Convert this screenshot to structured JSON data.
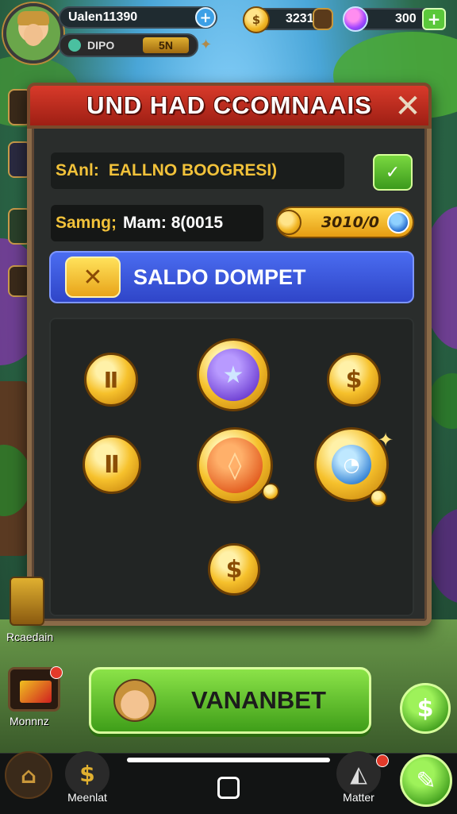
{
  "player": {
    "name": "Ualen11390",
    "rank_label": "DIPO",
    "rank_value": "5N"
  },
  "currency": {
    "coins": "3231",
    "gems": "300"
  },
  "modal": {
    "title": "UND HAD CCOMNAAIS",
    "close": "✕",
    "row1_label": "SAnl:",
    "row1_value": "EALLNO BOOGRESI)",
    "row2_label": "Samng;",
    "row2_name": "Mam: 8(0015",
    "balance": "3010/0",
    "saldo_label": "SALDO DOMPET",
    "saldo_icon": "✕"
  },
  "coins_grid": [
    {
      "symbol": "Ⅱ",
      "kind": "gold"
    },
    {
      "symbol": "★",
      "kind": "purple"
    },
    {
      "symbol": "$",
      "kind": "gold"
    },
    {
      "symbol": "Ⅱ",
      "kind": "gold"
    },
    {
      "symbol": "◊",
      "kind": "orange"
    },
    {
      "symbol": "◔",
      "kind": "blue"
    },
    {
      "symbol": "$",
      "kind": "gold"
    }
  ],
  "side": {
    "top_label": "Rcaedain",
    "bottom_label": "Monnnz"
  },
  "cta": {
    "label": "VANANBET"
  },
  "nav": {
    "left_label": "Meenlat",
    "right_label": "Matter"
  },
  "icons": {
    "plus": "+",
    "dollar": "$",
    "check": "✓"
  }
}
